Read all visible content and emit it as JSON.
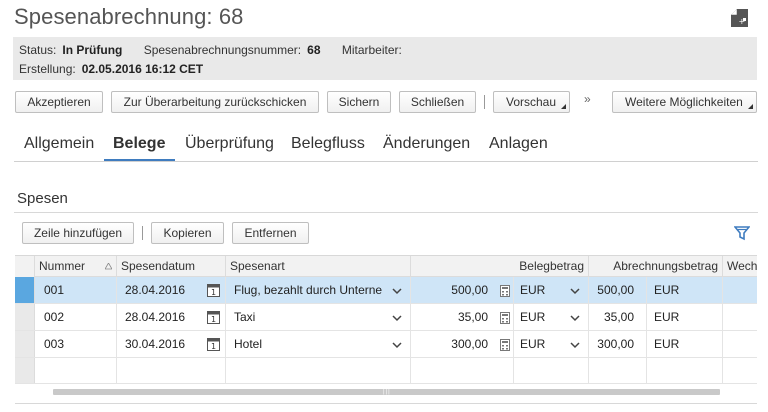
{
  "page": {
    "title": "Spesenabrechnung: 68"
  },
  "header": {
    "status_label": "Status:",
    "status_value": "In Prüfung",
    "number_label": "Spesenabrechnungsnummer:",
    "number_value": "68",
    "employee_label": "Mitarbeiter:",
    "employee_value": "",
    "created_label": "Erstellung:",
    "created_value": "02.05.2016 16:12 CET"
  },
  "toolbar": {
    "accept": "Akzeptieren",
    "send_back": "Zur Überarbeitung zurückschicken",
    "save": "Sichern",
    "close": "Schließen",
    "preview": "Vorschau",
    "overflow": "»",
    "more": "Weitere Möglichkeiten"
  },
  "tabs": [
    {
      "label": "Allgemein"
    },
    {
      "label": "Belege"
    },
    {
      "label": "Überprüfung"
    },
    {
      "label": "Belegfluss"
    },
    {
      "label": "Änderungen"
    },
    {
      "label": "Anlagen"
    }
  ],
  "section": {
    "title": "Spesen"
  },
  "table_toolbar": {
    "add_row": "Zeile hinzufügen",
    "copy": "Kopieren",
    "remove": "Entfernen"
  },
  "table": {
    "columns": {
      "number": "Nummer",
      "date": "Spesendatum",
      "type": "Spesenart",
      "amount": "Belegbetrag",
      "settlement": "Abrechnungsbetrag",
      "exchange": "Wech"
    },
    "rows": [
      {
        "number": "001",
        "date": "28.04.2016",
        "type": "Flug, bezahlt durch Unterne",
        "amount": "500,00",
        "currency": "EUR",
        "settlement": "500,00",
        "settlement_currency": "EUR"
      },
      {
        "number": "002",
        "date": "28.04.2016",
        "type": "Taxi",
        "amount": "35,00",
        "currency": "EUR",
        "settlement": "35,00",
        "settlement_currency": "EUR"
      },
      {
        "number": "003",
        "date": "30.04.2016",
        "type": "Hotel",
        "amount": "300,00",
        "currency": "EUR",
        "settlement": "300,00",
        "settlement_currency": "EUR"
      }
    ]
  },
  "colors": {
    "accent": "#3f7cbf",
    "selected_row": "#cfe5f7",
    "selected_marker": "#5aa7e0"
  }
}
